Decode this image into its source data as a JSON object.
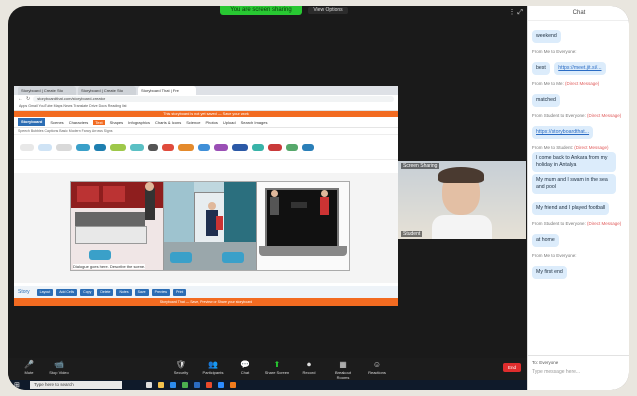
{
  "zoom": {
    "sharing_label": "You are screen sharing",
    "view_options": "View Options",
    "top_right": "⋮ ⤢"
  },
  "browser": {
    "tabs": [
      "Storyboard | Create Sto",
      "Storyboard | Create Sto",
      "Storyboard That | Fre"
    ],
    "url": "storyboardthat.com/storyboard-creator",
    "bookmarks": "Apps  Gmail  YouTube  Maps  News  Translate  Drive  Docs  Reading list",
    "notice": "This storyboard is not yet saved — Save your work",
    "app_logo": "Storyboard",
    "menu": [
      "Scenes",
      "Characters",
      "Text",
      "Shapes",
      "Infographics",
      "Charts & Icons",
      "Science",
      "Photos",
      "Upload",
      "Search Images"
    ],
    "menu_highlight": "Text",
    "subbar": "Speech  Bubbles  Captions  Basic  Modern  Fancy  Arrows  Signs",
    "caption": "Dialogue goes here. Describe the scene.",
    "toolbar_label": "Story",
    "toolbar_buttons": [
      "Layout",
      "Add Cells",
      "Copy",
      "Delete",
      "Notes",
      "Save",
      "Preview",
      "Print"
    ],
    "footer": "Storyboard That — Save, Preview or Share your storyboard"
  },
  "video": {
    "top_name": "Screen Sharing",
    "bottom_name": "Student"
  },
  "controls": [
    {
      "icon": "🎤",
      "label": "Mute"
    },
    {
      "icon": "📹",
      "label": "Stop Video"
    },
    {
      "icon": "🛡",
      "label": "Security"
    },
    {
      "icon": "👥",
      "label": "Participants"
    },
    {
      "icon": "💬",
      "label": "Chat"
    },
    {
      "icon": "⬆",
      "label": "Share Screen"
    },
    {
      "icon": "⏺",
      "label": "Record"
    },
    {
      "icon": "▦",
      "label": "Breakout Rooms"
    },
    {
      "icon": "☺",
      "label": "Reactions"
    }
  ],
  "end_label": "End",
  "taskbar": {
    "search": "Type here to search"
  },
  "chat": {
    "title": "Chat",
    "messages": [
      {
        "from": "",
        "tag": "",
        "text": "weekend",
        "link": false
      },
      {
        "from": "From Me to Everyone:",
        "tag": "",
        "text": "best",
        "link": false
      },
      {
        "from": "",
        "tag": "",
        "text": "https://meet.jit.si/...",
        "link": true
      },
      {
        "from": "From Me to Me:",
        "tag": "(Direct Message)",
        "text": "matched",
        "link": false
      },
      {
        "from": "From Student to Everyone:",
        "tag": "(Direct Message)",
        "text": "https://storyboardthat...",
        "link": true
      },
      {
        "from": "From Me to Student:",
        "tag": "(Direct Message)",
        "text": "I come back to Ankara from my holiday in Antalya",
        "link": false
      },
      {
        "from": "",
        "tag": "",
        "text": "My mum and I swam in the sea and pool",
        "link": false
      },
      {
        "from": "",
        "tag": "",
        "text": "My friend and I played football",
        "link": false
      },
      {
        "from": "From Student to Everyone:",
        "tag": "(Direct Message)",
        "text": "at home",
        "link": false
      },
      {
        "from": "From Me to Everyone:",
        "tag": "",
        "text": "My first end",
        "link": false
      }
    ],
    "to_label": "To: Everyone",
    "placeholder": "Type message here..."
  }
}
